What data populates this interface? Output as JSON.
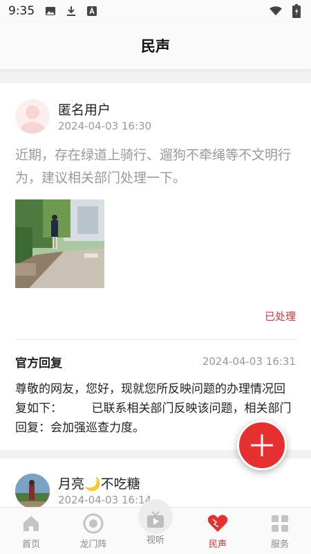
{
  "status_bar": {
    "time": "9:35",
    "icons": [
      "image-icon",
      "download-icon",
      "font-icon",
      "wifi-icon",
      "battery-icon"
    ]
  },
  "header": {
    "title": "民声"
  },
  "post": {
    "user_name": "匿名用户",
    "time": "2024-04-03 16:30",
    "content": "近期，存在绿道上骑行、遛狗不牵绳等不文明行为，建议相关部门处理一下。",
    "status": "已处理",
    "reply": {
      "title": "官方回复",
      "time": "2024-04-03 16:31",
      "content": "尊敬的网友，您好，现就您所反映问题的办理情况回复如下：　　　已联系相关部门反映该问题，相关部门回复：会加强巡查力度。"
    }
  },
  "post2": {
    "user_name": "月亮🌙不吃糖",
    "time": "2024-04-03 16:14"
  },
  "tabs": [
    {
      "label": "首页",
      "icon": "home-icon",
      "active": false
    },
    {
      "label": "龙门阵",
      "icon": "target-icon",
      "active": false
    },
    {
      "label": "视听",
      "icon": "tv-play-icon",
      "active": false
    },
    {
      "label": "民声",
      "icon": "heart-icon",
      "active": true
    },
    {
      "label": "服务",
      "icon": "grid-icon",
      "active": false
    }
  ],
  "colors": {
    "accent": "#e62f2f",
    "muted_text": "#999999"
  }
}
